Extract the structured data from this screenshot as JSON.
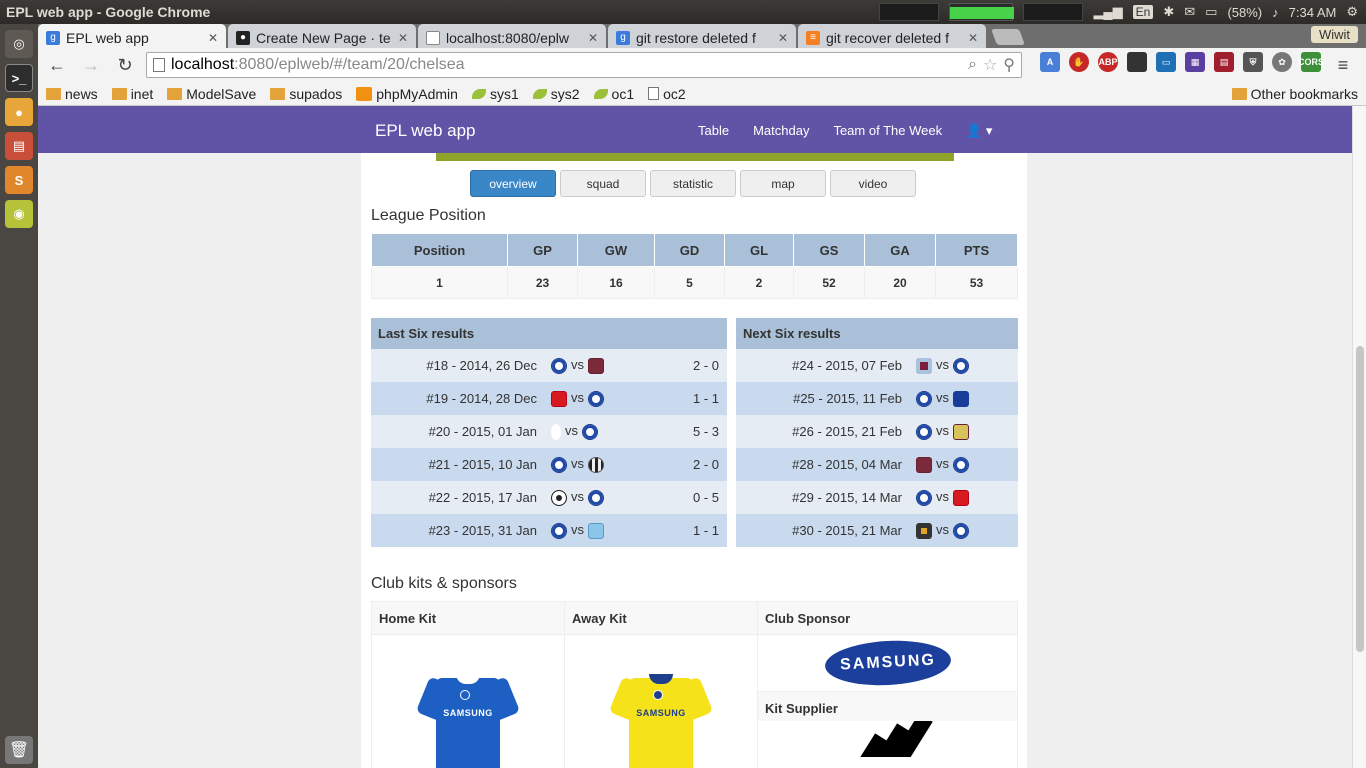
{
  "os": {
    "window_title": "EPL web app - Google Chrome",
    "lang": "En",
    "battery": "(58%)",
    "time": "7:34 AM"
  },
  "launcher": {
    "items": [
      "ubuntu-icon",
      "terminal-icon",
      "chrome-icon",
      "files-icon",
      "sublime-icon",
      "app-icon"
    ],
    "trash": "trash-icon"
  },
  "browser": {
    "tabs": [
      {
        "title": "EPL web app",
        "icon": "google-icon",
        "active": true
      },
      {
        "title": "Create New Page · te",
        "icon": "github-icon"
      },
      {
        "title": "localhost:8080/eplw",
        "icon": "page-icon"
      },
      {
        "title": "git restore deleted f",
        "icon": "google-icon"
      },
      {
        "title": "git recover deleted f",
        "icon": "stackoverflow-icon"
      }
    ],
    "wiwit": "Wiwit",
    "url_host": "localhost",
    "url_rest": ":8080/eplweb/#/team/20/chelsea",
    "extensions": [
      "translate",
      "stop",
      "ABP",
      "ext4",
      "ext5",
      "ext6",
      "ext7",
      "shield",
      "ext9",
      "CORS"
    ],
    "bookmarks": [
      {
        "label": "news",
        "icon": "folder"
      },
      {
        "label": "inet",
        "icon": "folder"
      },
      {
        "label": "ModelSave",
        "icon": "folder"
      },
      {
        "label": "supados",
        "icon": "folder"
      },
      {
        "label": "phpMyAdmin",
        "icon": "pma"
      },
      {
        "label": "sys1",
        "icon": "leaf"
      },
      {
        "label": "sys2",
        "icon": "leaf"
      },
      {
        "label": "oc1",
        "icon": "leaf"
      },
      {
        "label": "oc2",
        "icon": "page"
      }
    ],
    "other_bookmarks": "Other bookmarks"
  },
  "app": {
    "brand": "EPL web app",
    "nav": [
      "Table",
      "Matchday",
      "Team of The Week"
    ],
    "subtabs": [
      "overview",
      "squad",
      "statistic",
      "map",
      "video"
    ],
    "active_subtab": "overview",
    "league_position_title": "League Position",
    "league_position": {
      "headers": [
        "Position",
        "GP",
        "GW",
        "GD",
        "GL",
        "GS",
        "GA",
        "PTS"
      ],
      "values": [
        "1",
        "23",
        "16",
        "5",
        "2",
        "52",
        "20",
        "53"
      ]
    },
    "last_six": {
      "title": "Last Six results",
      "rows": [
        {
          "match": "#18 - 2014, 26 Dec",
          "home": "chelsea",
          "away": "westham",
          "score": "2 - 0"
        },
        {
          "match": "#19 - 2014, 28 Dec",
          "home": "southampton",
          "away": "chelsea",
          "score": "1 - 1"
        },
        {
          "match": "#20 - 2015, 01 Jan",
          "home": "spurs",
          "away": "chelsea",
          "score": "5 - 3"
        },
        {
          "match": "#21 - 2015, 10 Jan",
          "home": "chelsea",
          "away": "newcastle",
          "score": "2 - 0"
        },
        {
          "match": "#22 - 2015, 17 Jan",
          "home": "swansea",
          "away": "chelsea",
          "score": "0 - 5"
        },
        {
          "match": "#23 - 2015, 31 Jan",
          "home": "chelsea",
          "away": "mancity",
          "score": "1 - 1"
        }
      ]
    },
    "next_six": {
      "title": "Next Six results",
      "rows": [
        {
          "match": "#24 - 2015, 07 Feb",
          "home": "villa",
          "away": "chelsea"
        },
        {
          "match": "#25 - 2015, 11 Feb",
          "home": "chelsea",
          "away": "everton"
        },
        {
          "match": "#26 - 2015, 21 Feb",
          "home": "chelsea",
          "away": "burnley"
        },
        {
          "match": "#28 - 2015, 04 Mar",
          "home": "westham",
          "away": "chelsea"
        },
        {
          "match": "#29 - 2015, 14 Mar",
          "home": "chelsea",
          "away": "southampton"
        },
        {
          "match": "#30 - 2015, 21 Mar",
          "home": "hull",
          "away": "chelsea"
        }
      ]
    },
    "vs": "vs",
    "kits_title": "Club kits & sponsors",
    "kits": {
      "home_label": "Home Kit",
      "away_label": "Away Kit",
      "sponsor_label": "Club Sponsor",
      "supplier_label": "Kit Supplier",
      "home_sponsor_text": "SAMSUNG",
      "away_sponsor_text": "SAMSUNG",
      "sponsor_logo_text": "SAMSUNG"
    },
    "colors": {
      "navbar": "#6154a6",
      "header_cell": "#a9c0d8",
      "row_light": "#e6ecf4",
      "row_dark": "#c9d9ee",
      "home_kit": "#1d5fc2",
      "away_kit": "#f5e21a"
    }
  }
}
